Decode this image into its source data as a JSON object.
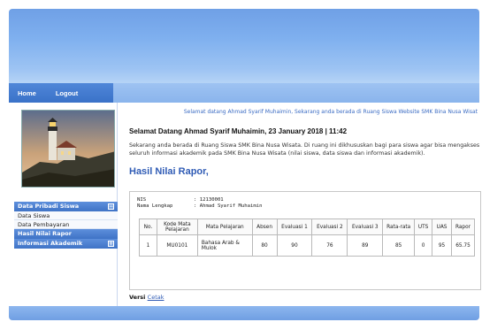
{
  "nav": {
    "home": "Home",
    "logout": "Logout"
  },
  "sidebar": {
    "sections": [
      {
        "title": "Data Pribadi Siswa",
        "toggle": "⊟",
        "items": [
          "Data Siswa",
          "Data Pembayaran"
        ]
      },
      {
        "title": "Hasil Nilai Rapor",
        "toggle": "",
        "items": []
      },
      {
        "title": "Informasi Akademik",
        "toggle": "⊞",
        "items": []
      }
    ]
  },
  "content": {
    "marquee": "Selamat datang Ahmad Syarif Muhaimin, Sekarang anda berada di Ruang Siswa Website SMK Bina Nusa Wisat",
    "welcome": "Selamat Datang Ahmad Syarif Muhaimin, 23 January 2018 | 11:42",
    "intro": "Sekarang anda berada di Ruang Siswa SMK Bina Nusa Wisata. Di ruang ini dikhususkan bagi para siswa agar bisa mengakses seluruh informasi akademik pada SMK Bina Nusa Wisata (nilai siswa, data siswa dan informasi akademik).",
    "section_title": "Hasil Nilai Rapor,",
    "nis_label": "NIS",
    "nis_value": ": 12130001",
    "nama_label": "Nama Lengkap",
    "nama_value": ": Ahmad Syarif Muhaimin",
    "versi_label": "Versi",
    "cetak_link": "Cetak"
  },
  "table": {
    "headers": [
      "No.",
      "Kode Mata Pelajaran",
      "Mata Pelajaran",
      "Absen",
      "Evaluasi 1",
      "Evaluasi 2",
      "Evaluasi 3",
      "Rata-rata",
      "UTS",
      "UAS",
      "Rapor"
    ],
    "rows": [
      [
        "1",
        "MU0101",
        "Bahasa Arab & Mulok",
        "80",
        "90",
        "76",
        "89",
        "85",
        "0",
        "95",
        "65.75"
      ]
    ]
  }
}
